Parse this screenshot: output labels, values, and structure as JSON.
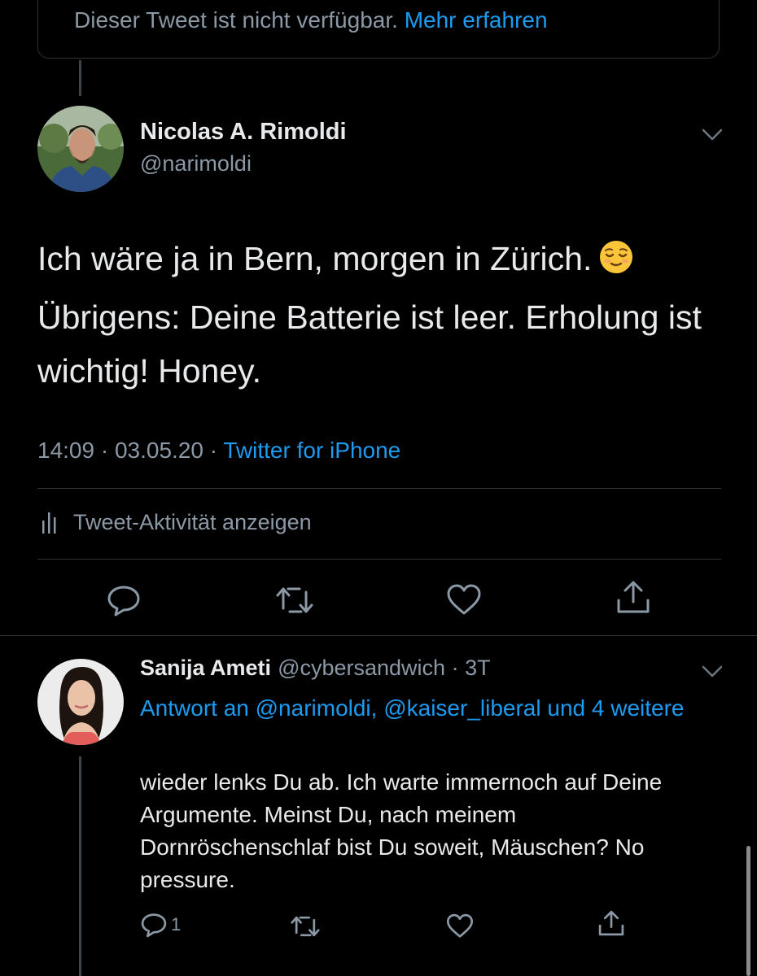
{
  "unavailable": {
    "text": "Dieser Tweet ist nicht verfügbar.",
    "link": "Mehr erfahren"
  },
  "main_tweet": {
    "author_name": "Nicolas A. Rimoldi",
    "author_handle": "@narimoldi",
    "text_line1": "Ich wäre ja in Bern, morgen in Zürich.",
    "text_rest": "Übrigens: Deine Batterie ist leer. Erholung ist wichtig! Honey.",
    "emoji": "relieved-face",
    "time": "14:09",
    "date": "03.05.20",
    "source": "Twitter for iPhone",
    "activity_label": "Tweet-Aktivität anzeigen"
  },
  "reply": {
    "author_name": "Sanija Ameti",
    "author_handle": "@cybersandwich",
    "age": "3T",
    "reply_to": "Antwort an @narimoldi, @kaiser_liberal und 4 weitere",
    "text": "wieder lenks Du ab. Ich warte immernoch auf Deine Argumente. Meinst Du, nach meinem Dornröschenschlaf bist Du soweit, Mäuschen? No pressure.",
    "reply_count": "1"
  },
  "icons": [
    "chevron-down-icon",
    "stats-icon",
    "reply-icon",
    "retweet-icon",
    "like-icon",
    "share-icon"
  ],
  "colors": {
    "background": "#000000",
    "link": "#1d9bf0",
    "secondary_text": "#8b98a5",
    "divider": "#2f3336"
  }
}
